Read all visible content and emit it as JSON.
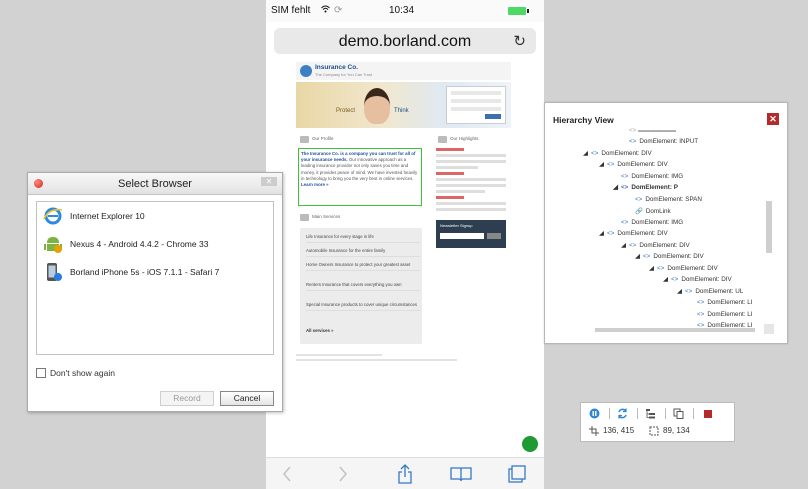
{
  "phone": {
    "carrier": "SIM fehlt",
    "time": "10:34",
    "url": "demo.borland.com",
    "icons": {
      "reload": "reload-icon",
      "back": "back-arrow-icon",
      "forward": "forward-arrow-icon",
      "share": "share-icon",
      "bookmarks": "book-icon",
      "tabs": "tabs-icon"
    }
  },
  "site": {
    "company": "Insurance Co.",
    "tagline": "The Company for You Can Trust",
    "banner_left": "Protect",
    "banner_right": "Think",
    "profile_heading": "Our Profile",
    "highlights_heading": "Our Highlights",
    "highlight_strong": "The Insurance Co. is a company you can trust for all of your insurance needs.",
    "highlight_text": "Our innovative approach as a leading insurance provider not only saves you time and money, it provides peace of mind. We have invested heavily in technology to bring you the very best in online services.",
    "learn_more": "Learn more »",
    "services_heading": "Main Services",
    "services": [
      "Life Insurance for every stage in life",
      "Automobile Insurance for the entire family",
      "Home Owners Insurance to protect your greatest asset",
      "Renters Insurance that covers everything you own",
      "Special Insurance products to cover unique circumstances"
    ],
    "all_services": "All services »",
    "newsletter": "Newsletter Signup"
  },
  "dialog": {
    "title": "Select Browser",
    "browsers": [
      {
        "label": "Internet Explorer 10",
        "icon": "internet-explorer-icon"
      },
      {
        "label": "Nexus 4 - Android 4.4.2 - Chrome 33",
        "icon": "android-icon"
      },
      {
        "label": "Borland iPhone 5s - iOS 7.1.1 - Safari 7",
        "icon": "iphone-icon"
      }
    ],
    "dont_show": "Don't show again",
    "record": "Record",
    "cancel": "Cancel"
  },
  "hierarchy": {
    "title": "Hierarchy View",
    "nodes": [
      {
        "label": "DomElement: INPUT",
        "icon": "<>",
        "expander": ""
      },
      {
        "label": "DomElement: DIV",
        "icon": "<>",
        "expander": "◢"
      },
      {
        "label": "DomElement: DIV",
        "icon": "<>",
        "expander": "◢"
      },
      {
        "label": "DomElement: IMG",
        "icon": "<>",
        "expander": ""
      },
      {
        "label": "DomElement: P",
        "icon": "<>",
        "expander": "◢"
      },
      {
        "label": "DomElement: SPAN",
        "icon": "<>",
        "expander": ""
      },
      {
        "label": "DomLink",
        "icon": "link",
        "expander": ""
      },
      {
        "label": "DomElement: IMG",
        "icon": "<>",
        "expander": ""
      },
      {
        "label": "DomElement: DIV",
        "icon": "<>",
        "expander": "◢"
      },
      {
        "label": "DomElement: DIV",
        "icon": "<>",
        "expander": "◢"
      },
      {
        "label": "DomElement: DIV",
        "icon": "<>",
        "expander": "◢"
      },
      {
        "label": "DomElement: DIV",
        "icon": "<>",
        "expander": "◢"
      },
      {
        "label": "DomElement: DIV",
        "icon": "<>",
        "expander": "◢"
      },
      {
        "label": "DomElement: UL",
        "icon": "<>",
        "expander": "◢"
      },
      {
        "label": "DomElement: LI",
        "icon": "<>",
        "expander": ""
      },
      {
        "label": "DomElement: LI",
        "icon": "<>",
        "expander": ""
      },
      {
        "label": "DomElement: LI",
        "icon": "<>",
        "expander": ""
      }
    ]
  },
  "inspector": {
    "position": "136, 415",
    "size": "89, 134"
  }
}
